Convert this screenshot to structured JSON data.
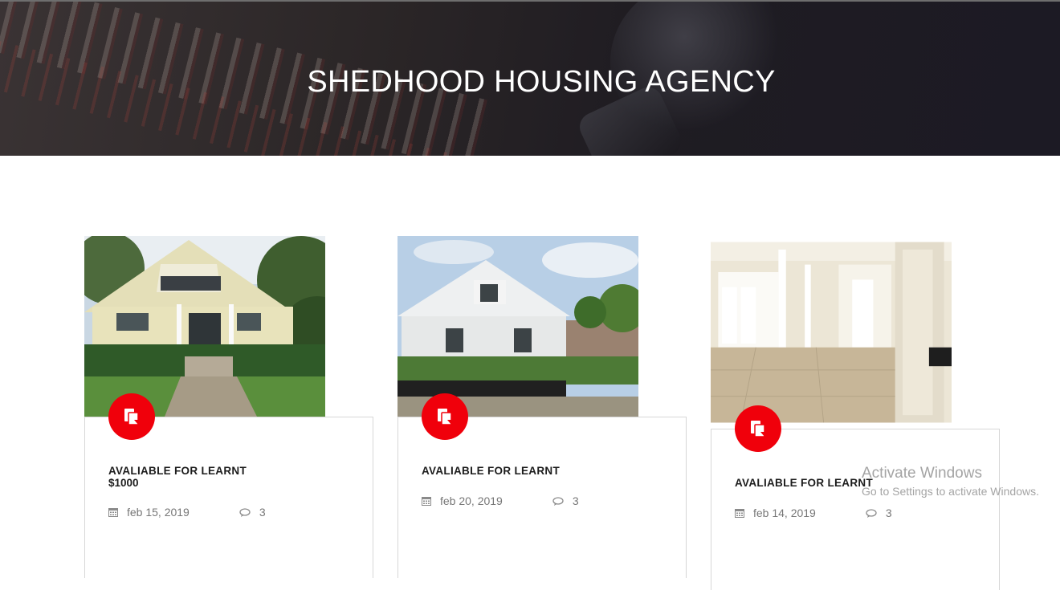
{
  "header": {
    "title": "SHEDHOOD HOUSING AGENCY"
  },
  "listings": [
    {
      "title": "AVALIABLE FOR LEARNT",
      "price": "$1000",
      "date": "feb 15, 2019",
      "comments": "3",
      "icon": "document-icon",
      "photo": "bungalow-exterior-yellow"
    },
    {
      "title": "AVALIABLE FOR LEARNT",
      "date": "feb 20, 2019",
      "comments": "3",
      "icon": "document-icon",
      "photo": "bungalow-exterior-white"
    },
    {
      "title": "AVALIABLE FOR LEARNT",
      "date": "feb 14, 2019",
      "comments": "3",
      "icon": "document-icon",
      "photo": "interior-hallway"
    }
  ],
  "watermark": {
    "title": "Activate Windows",
    "subtitle": "Go to Settings to activate Windows."
  },
  "colors": {
    "accent": "#f0000b",
    "hero_bg": "#2a2627",
    "card_border": "#d7d7d7"
  },
  "icons": {
    "date": "calendar-icon",
    "comments": "comment-icon",
    "badge": "document-icon"
  }
}
